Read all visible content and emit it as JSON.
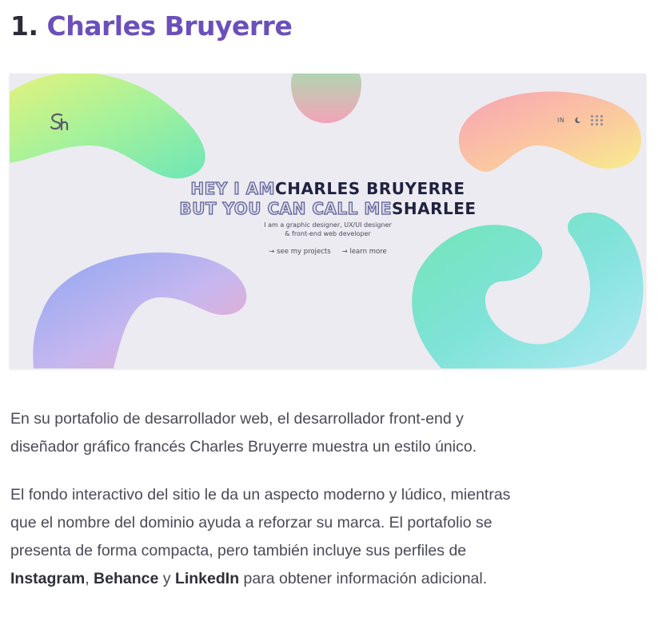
{
  "heading": {
    "number": "1.",
    "name": "Charles Bruyerre"
  },
  "screenshot": {
    "logo_icon": "charles-bruyerre-monogram",
    "nav": {
      "in_label": "IN",
      "moon_icon": "moon-icon",
      "grid_icon": "grid-dots-icon"
    },
    "hero": {
      "line1_outline": "HEY I AM",
      "line1_solid": "CHARLES BRUYERRE",
      "line2_outline": "BUT YOU CAN CALL ME",
      "line2_solid": "SHARLEE",
      "sub1": "I am a graphic designer, UX/UI designer",
      "sub2": "& front-end web developer",
      "link1": "→ see my projects",
      "link2": "→ learn more"
    }
  },
  "paragraphs": {
    "p1_line1": "En su portafolio de desarrollador web, el desarrollador front-end y",
    "p1_line2": "diseñador gráfico francés Charles Bruyerre muestra un estilo único.",
    "p2_line1": "El fondo interactivo del sitio le da un aspecto moderno y lúdico, mientras",
    "p2_line2": "que el nombre del dominio ayuda a reforzar su marca. El portafolio se",
    "p2_line3": "presenta de forma compacta, pero también incluye sus perfiles de",
    "p2_link_instagram": "Instagram",
    "p2_sep1": ", ",
    "p2_link_behance": "Behance",
    "p2_sep2": " y ",
    "p2_link_linkedin": "LinkedIn",
    "p2_tail": " para obtener información adicional."
  }
}
